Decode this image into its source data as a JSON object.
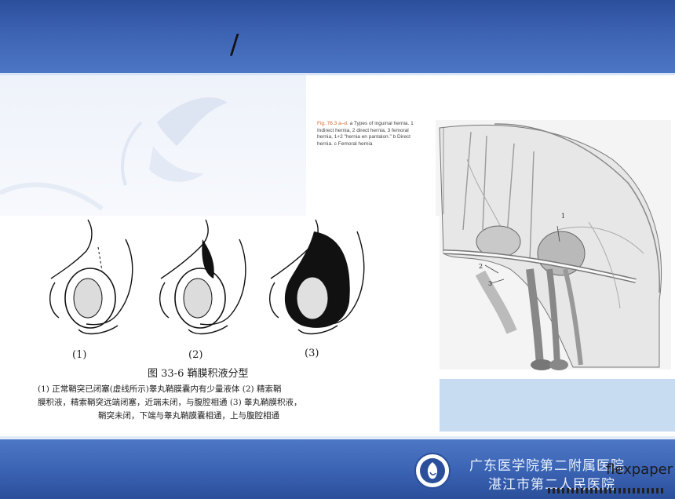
{
  "slide": {
    "title": "/"
  },
  "left_figure": {
    "panel_labels": [
      "(1)",
      "(2)",
      "(3)"
    ],
    "caption_title": "图 33-6   鞘膜积液分型",
    "caption_lines": [
      "(1) 正常鞘突已闭塞(虚线所示)睾丸鞘膜囊内有少量液体   (2) 精索鞘",
      "膜积液，精索鞘突远端闭塞，近端未闭，与腹腔相通   (3) 睾丸鞘膜积液，",
      "鞘突未闭，下端与睾丸鞘膜囊相通，上与腹腔相通"
    ]
  },
  "right_figure": {
    "caption_lead": "Fig. 76.3 a–d.",
    "caption_body": "a Types of inguinal hernia. 1 Indirect hernia, 2 direct hernia, 3 femoral hernia, 1+2 \"hernia en pantalon.\" b Direct hernia. c Femoral hernia",
    "labels": [
      "1",
      "2",
      "3"
    ]
  },
  "footer": {
    "hospital_line1": "广东医学院第二附属医院",
    "hospital_line2": "湛江市第二人民医院",
    "watermark": "flexpaper"
  },
  "icons": {
    "logo": "hospital-emblem-icon",
    "deco": "butterfly-watermark-icon"
  },
  "colors": {
    "header_blue": "#3d63b3",
    "footer_blue": "#3a62b2",
    "band_light_blue": "#c8dcf1"
  }
}
